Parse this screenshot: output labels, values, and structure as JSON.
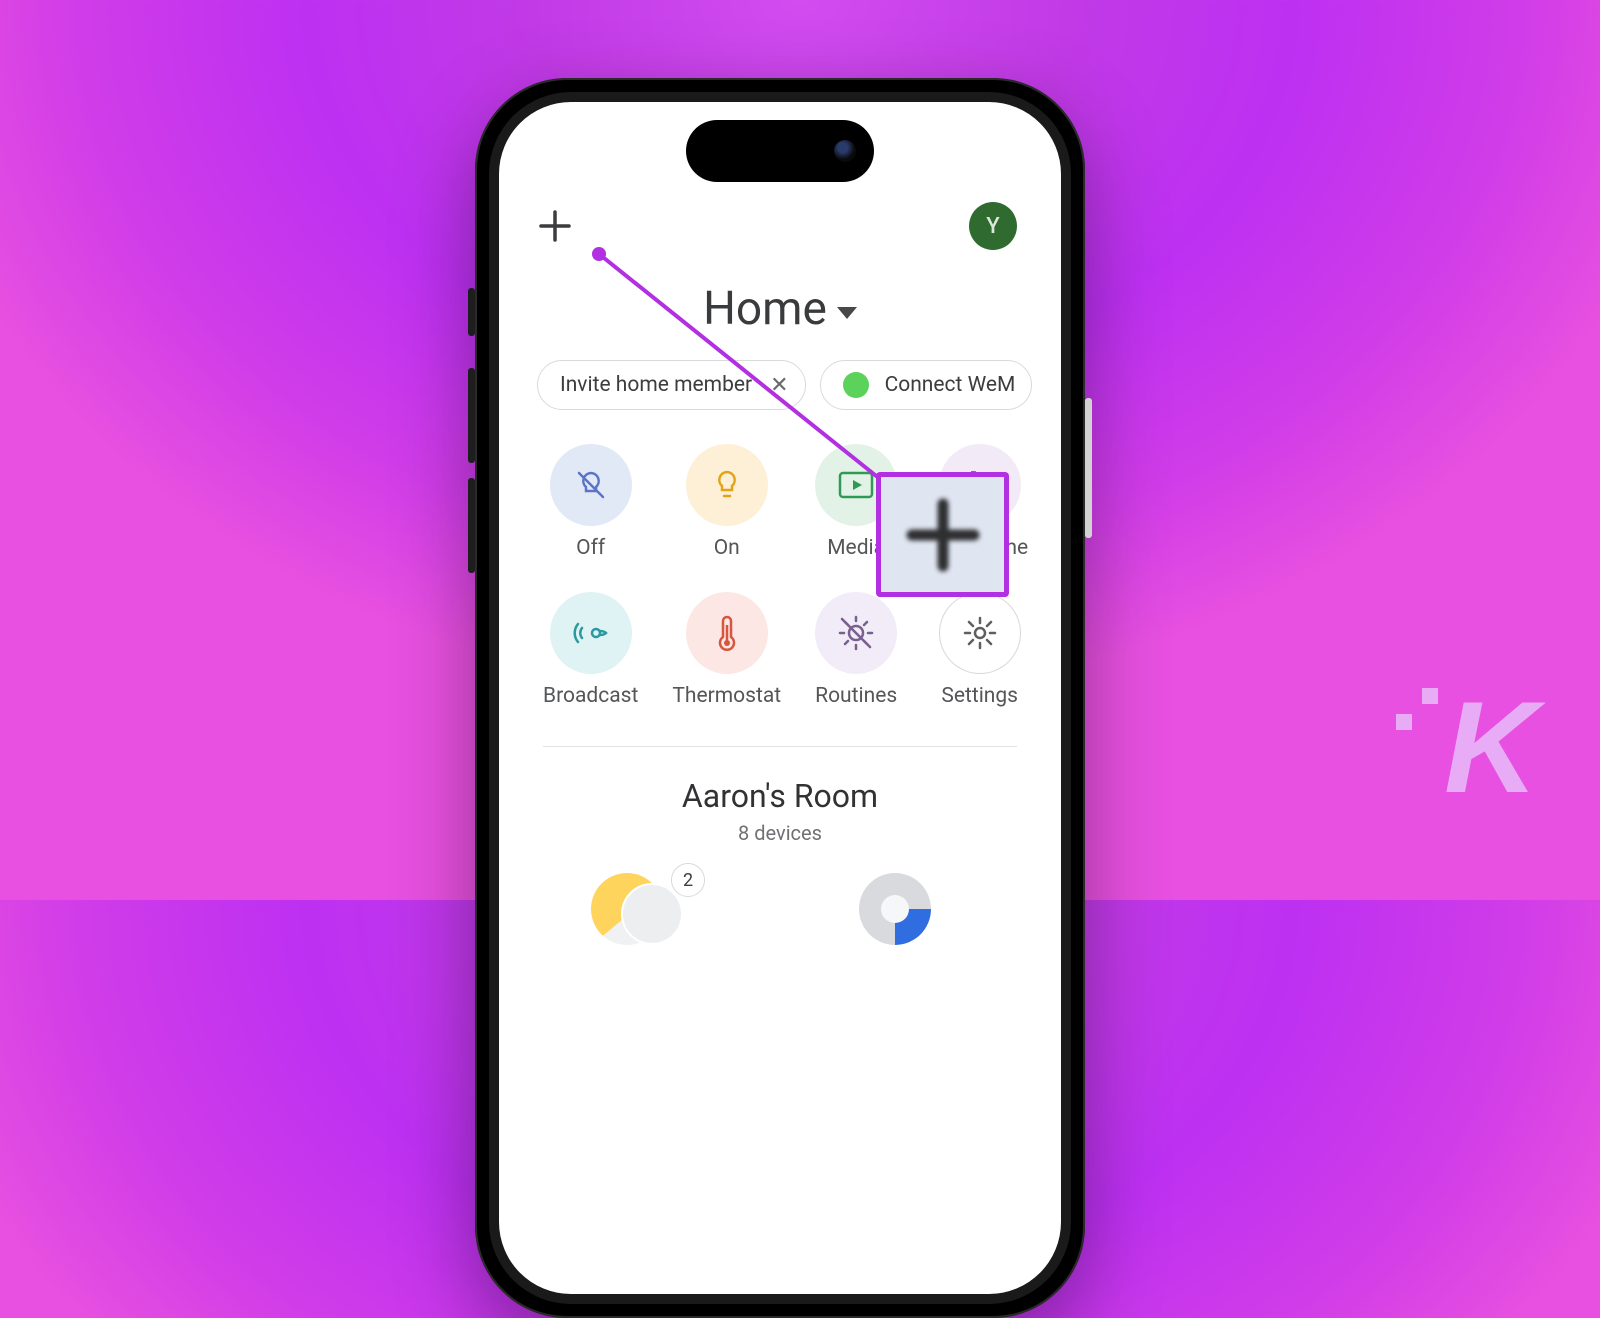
{
  "header": {
    "avatar_initial": "Y",
    "title": "Home"
  },
  "chips": {
    "invite": {
      "label": "Invite home member"
    },
    "connect": {
      "label": "Connect WeM"
    }
  },
  "shortcuts": {
    "off": {
      "label": "Off"
    },
    "on": {
      "label": "On"
    },
    "media": {
      "label": "Media"
    },
    "call_home": {
      "label": "Call Home"
    },
    "broadcast": {
      "label": "Broadcast"
    },
    "thermostat": {
      "label": "Thermostat"
    },
    "routines": {
      "label": "Routines"
    },
    "settings": {
      "label": "Settings"
    }
  },
  "room": {
    "name": "Aaron's Room",
    "subtitle": "8 devices",
    "light_badge": "2"
  },
  "watermark": {
    "letter": "K"
  },
  "colors": {
    "annotation": "#b22fe2",
    "avatar_bg": "#2f6a2f"
  }
}
